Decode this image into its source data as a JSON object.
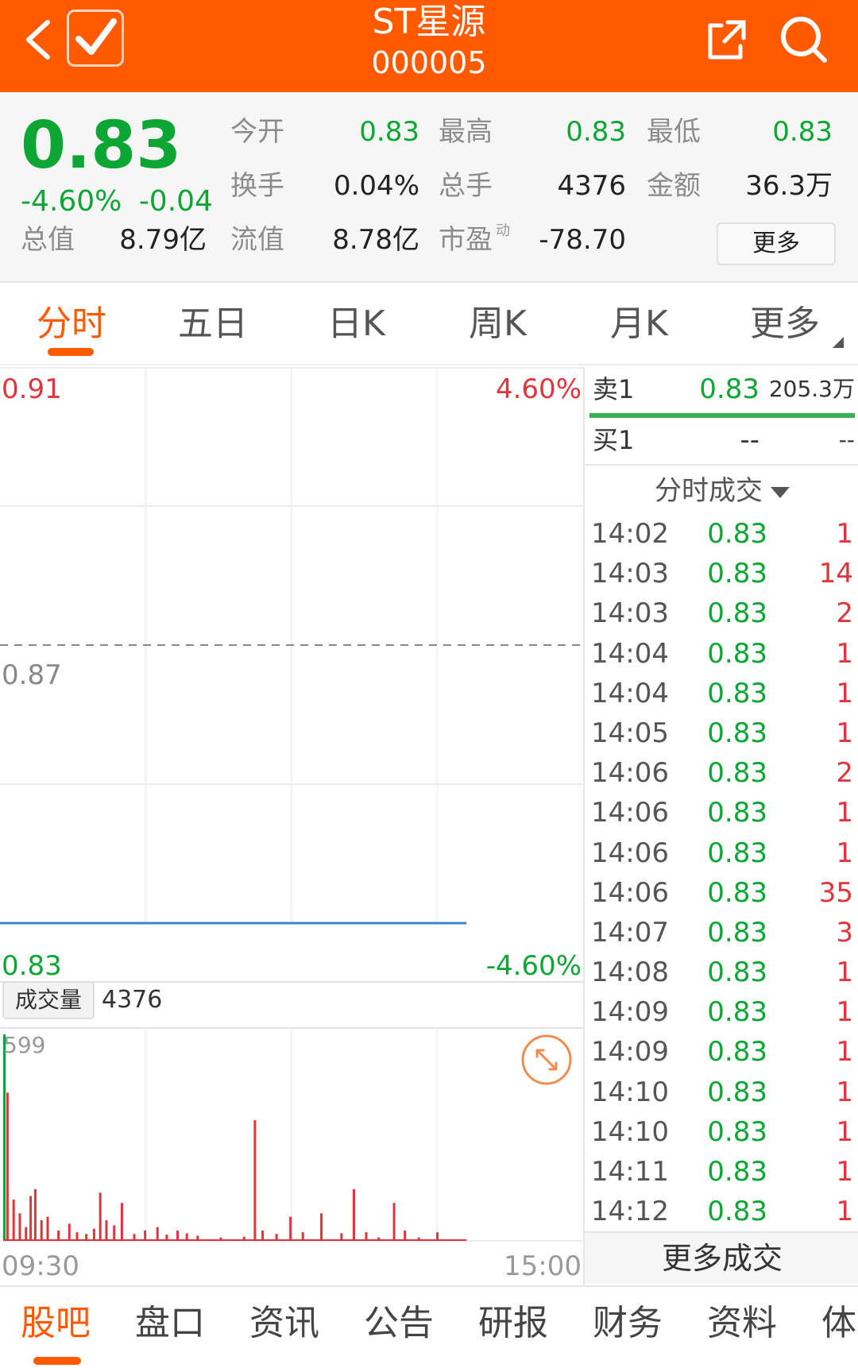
{
  "header": {
    "title": "ST星源",
    "code": "000005"
  },
  "quote": {
    "price": "0.83",
    "change_pct": "-4.60%",
    "change_abs": "-0.04",
    "stats": [
      {
        "label": "今开",
        "value": "0.83"
      },
      {
        "label": "最高",
        "value": "0.83"
      },
      {
        "label": "最低",
        "value": "0.83"
      },
      {
        "label": "换手",
        "value": "0.04%"
      },
      {
        "label": "总手",
        "value": "4376"
      },
      {
        "label": "金额",
        "value": "36.3万"
      },
      {
        "label": "总值",
        "value": "8.79亿"
      },
      {
        "label": "流值",
        "value": "8.78亿"
      },
      {
        "label": "市盈",
        "value": "-78.70"
      }
    ],
    "pe_superscript": "动",
    "more_label": "更多"
  },
  "tabs": [
    "分时",
    "五日",
    "日K",
    "周K",
    "月K",
    "更多"
  ],
  "chart": {
    "y_top": "0.91",
    "y_top_pct": "4.60%",
    "y_mid": "0.87",
    "y_bottom": "0.83",
    "y_bottom_pct": "-4.60%",
    "volume_label": "成交量",
    "volume_value": "4376",
    "volume_max": "599",
    "time_start": "09:30",
    "time_end": "15:00"
  },
  "chart_data": {
    "type": "bar",
    "title": "",
    "xlabel": "",
    "ylabel": "成交量",
    "xlim": [
      "09:30",
      "15:00"
    ],
    "ylim": [
      0,
      599
    ],
    "price_line": {
      "value": 0.83,
      "from": "09:30",
      "to": "14:12"
    },
    "reference_price": 0.87,
    "price_range": [
      0.83,
      0.91
    ],
    "pct_range": [
      "-4.60%",
      "4.60%"
    ],
    "volume_bars": [
      {
        "t": 0,
        "v": 599,
        "color": "green"
      },
      {
        "t": 2,
        "v": 430,
        "color": "red"
      },
      {
        "t": 6,
        "v": 120,
        "color": "red"
      },
      {
        "t": 10,
        "v": 80,
        "color": "red"
      },
      {
        "t": 14,
        "v": 40,
        "color": "red"
      },
      {
        "t": 17,
        "v": 130,
        "color": "red"
      },
      {
        "t": 20,
        "v": 150,
        "color": "red"
      },
      {
        "t": 24,
        "v": 60,
        "color": "red"
      },
      {
        "t": 28,
        "v": 70,
        "color": "red"
      },
      {
        "t": 35,
        "v": 30,
        "color": "red"
      },
      {
        "t": 42,
        "v": 50,
        "color": "red"
      },
      {
        "t": 47,
        "v": 25,
        "color": "red"
      },
      {
        "t": 53,
        "v": 20,
        "color": "red"
      },
      {
        "t": 58,
        "v": 35,
        "color": "red"
      },
      {
        "t": 62,
        "v": 140,
        "color": "red"
      },
      {
        "t": 66,
        "v": 60,
        "color": "red"
      },
      {
        "t": 71,
        "v": 45,
        "color": "red"
      },
      {
        "t": 76,
        "v": 110,
        "color": "red"
      },
      {
        "t": 84,
        "v": 20,
        "color": "red"
      },
      {
        "t": 91,
        "v": 30,
        "color": "red"
      },
      {
        "t": 99,
        "v": 40,
        "color": "red"
      },
      {
        "t": 105,
        "v": 18,
        "color": "red"
      },
      {
        "t": 112,
        "v": 30,
        "color": "red"
      },
      {
        "t": 118,
        "v": 22,
        "color": "red"
      },
      {
        "t": 125,
        "v": 15,
        "color": "red"
      },
      {
        "t": 140,
        "v": 10,
        "color": "red"
      },
      {
        "t": 155,
        "v": 12,
        "color": "red"
      },
      {
        "t": 162,
        "v": 350,
        "color": "red"
      },
      {
        "t": 167,
        "v": 30,
        "color": "red"
      },
      {
        "t": 176,
        "v": 20,
        "color": "red"
      },
      {
        "t": 185,
        "v": 70,
        "color": "red"
      },
      {
        "t": 193,
        "v": 25,
        "color": "red"
      },
      {
        "t": 205,
        "v": 80,
        "color": "red"
      },
      {
        "t": 218,
        "v": 22,
        "color": "red"
      },
      {
        "t": 226,
        "v": 150,
        "color": "red"
      },
      {
        "t": 234,
        "v": 25,
        "color": "red"
      },
      {
        "t": 242,
        "v": 10,
        "color": "red"
      },
      {
        "t": 252,
        "v": 110,
        "color": "red"
      },
      {
        "t": 259,
        "v": 30,
        "color": "red"
      },
      {
        "t": 268,
        "v": 10,
        "color": "red"
      },
      {
        "t": 280,
        "v": 25,
        "color": "red"
      }
    ]
  },
  "orderbook": {
    "sell1_label": "卖1",
    "sell1_price": "0.83",
    "sell1_vol": "205.3万",
    "buy1_label": "买1",
    "buy1_price": "--",
    "buy1_vol": "--"
  },
  "ticks": {
    "title": "分时成交",
    "rows": [
      {
        "time": "14:02",
        "price": "0.83",
        "vol": "1"
      },
      {
        "time": "14:03",
        "price": "0.83",
        "vol": "14"
      },
      {
        "time": "14:03",
        "price": "0.83",
        "vol": "2"
      },
      {
        "time": "14:04",
        "price": "0.83",
        "vol": "1"
      },
      {
        "time": "14:04",
        "price": "0.83",
        "vol": "1"
      },
      {
        "time": "14:05",
        "price": "0.83",
        "vol": "1"
      },
      {
        "time": "14:06",
        "price": "0.83",
        "vol": "2"
      },
      {
        "time": "14:06",
        "price": "0.83",
        "vol": "1"
      },
      {
        "time": "14:06",
        "price": "0.83",
        "vol": "1"
      },
      {
        "time": "14:06",
        "price": "0.83",
        "vol": "35"
      },
      {
        "time": "14:07",
        "price": "0.83",
        "vol": "3"
      },
      {
        "time": "14:08",
        "price": "0.83",
        "vol": "1"
      },
      {
        "time": "14:09",
        "price": "0.83",
        "vol": "1"
      },
      {
        "time": "14:09",
        "price": "0.83",
        "vol": "1"
      },
      {
        "time": "14:10",
        "price": "0.83",
        "vol": "1"
      },
      {
        "time": "14:10",
        "price": "0.83",
        "vol": "1"
      },
      {
        "time": "14:11",
        "price": "0.83",
        "vol": "1"
      },
      {
        "time": "14:12",
        "price": "0.83",
        "vol": "1"
      }
    ],
    "more_label": "更多成交"
  },
  "bottom_nav": [
    "股吧",
    "盘口",
    "资讯",
    "公告",
    "研报",
    "财务",
    "资料",
    "体"
  ],
  "colors": {
    "accent": "#ff5a00",
    "down": "#0ca634",
    "up": "#e0353b",
    "price_line": "#3a86c8"
  }
}
